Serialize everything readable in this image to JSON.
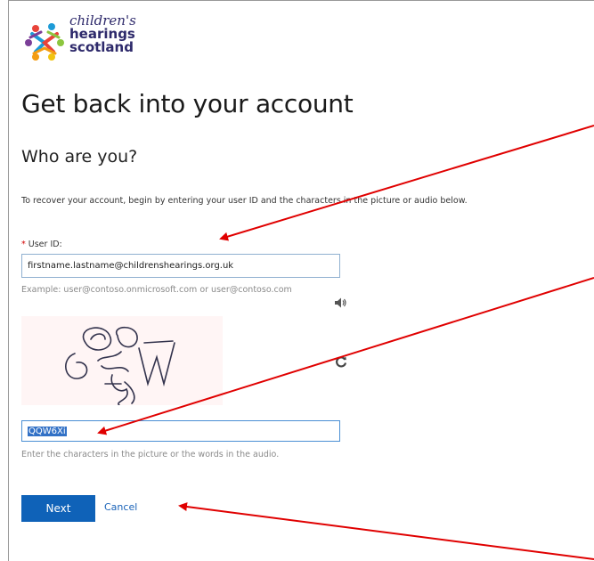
{
  "logo": {
    "line1": "children's",
    "line2": "hearings",
    "line3": "scotland"
  },
  "page": {
    "title": "Get back into your account",
    "subtitle": "Who are you?",
    "intro": "To recover your account, begin by entering your user ID and the characters in the picture or audio below."
  },
  "form": {
    "user_id_required_mark": "*",
    "user_id_label": " User ID:",
    "user_id_value": "firstname.lastname@childrenshearings.org.uk",
    "user_id_example": "Example: user@contoso.onmicrosoft.com or user@contoso.com",
    "captcha_value": "QQW6Xi",
    "captcha_hint": "Enter the characters in the picture or the words in the audio."
  },
  "buttons": {
    "next": "Next",
    "cancel": "Cancel"
  },
  "icons": {
    "audio": "speaker-icon",
    "refresh": "refresh-icon"
  },
  "colors": {
    "primary_button": "#0f62b8",
    "link": "#1a63b8",
    "annotation_arrows": "#e00000",
    "required": "#d40000"
  }
}
